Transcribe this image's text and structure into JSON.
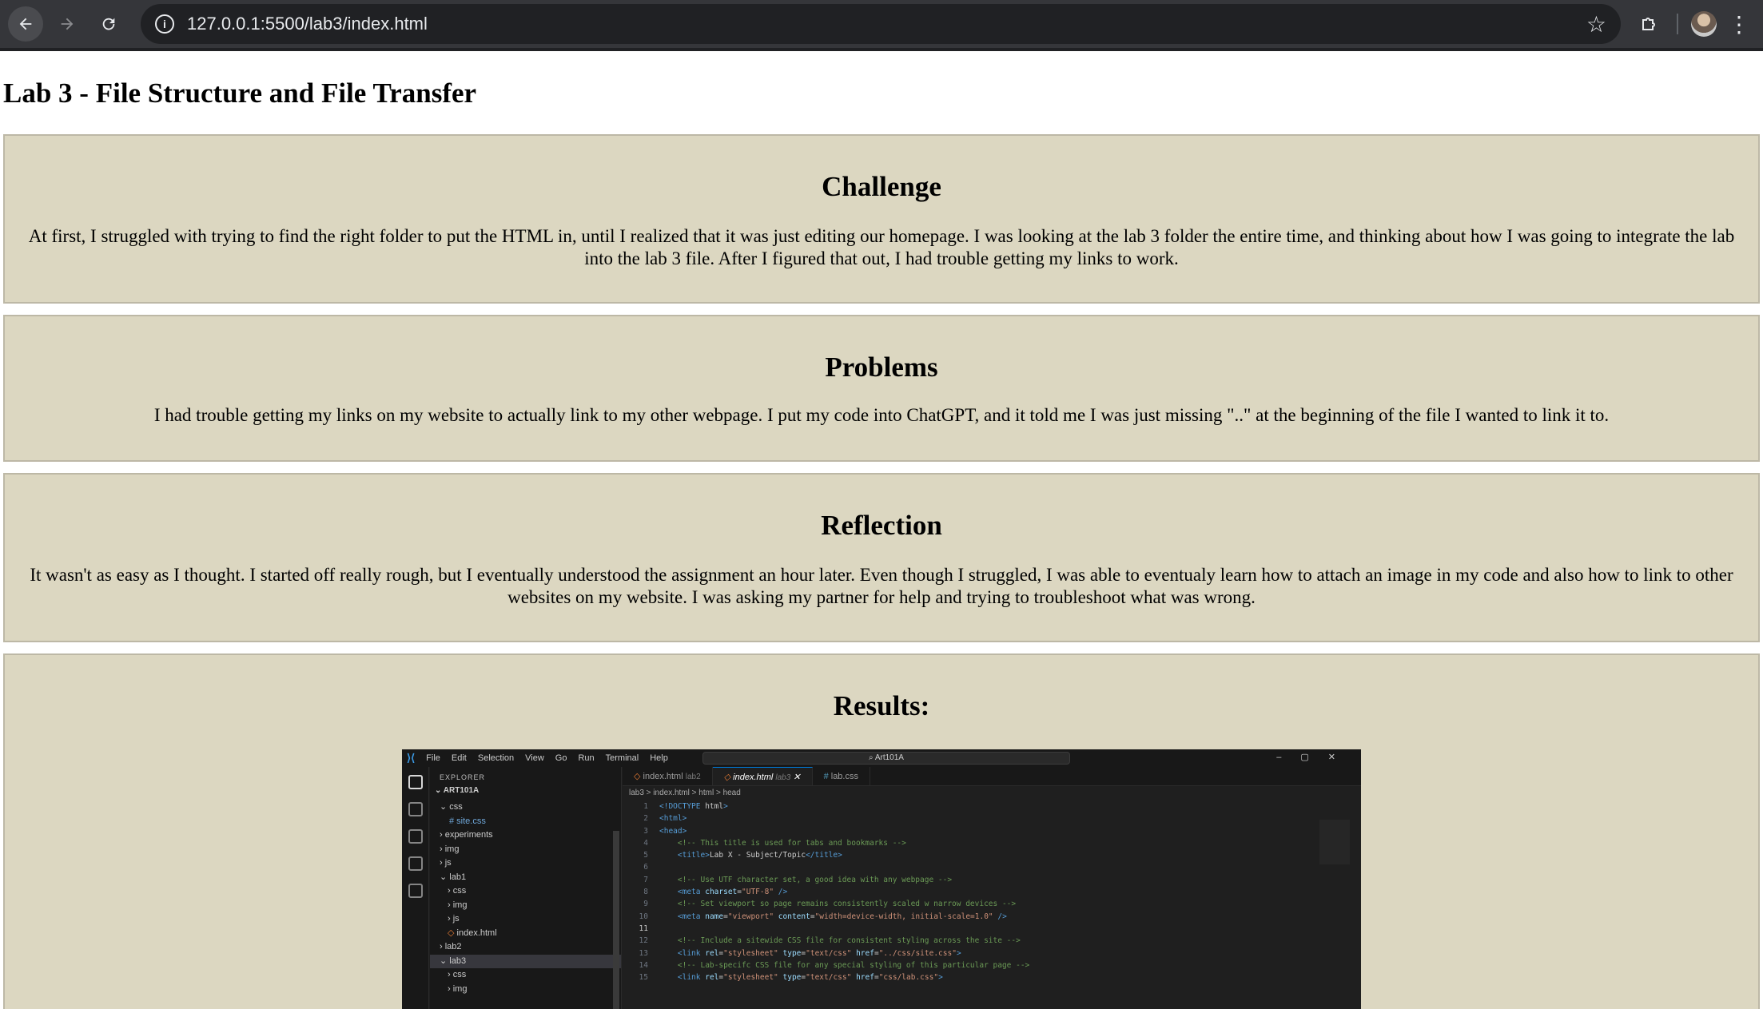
{
  "browser": {
    "url": "127.0.0.1:5500/lab3/index.html"
  },
  "page": {
    "title": "Lab 3 - File Structure and File Transfer",
    "sections": [
      {
        "heading": "Challenge",
        "text": "At first, I struggled with trying to find the right folder to put the HTML in, until I realized that it was just editing our homepage. I was looking at the lab 3 folder the entire time, and thinking about how I was going to integrate the lab into the lab 3 file. After I figured that out, I had trouble getting my links to work."
      },
      {
        "heading": "Problems",
        "text": "I had trouble getting my links on my website to actually link to my other webpage. I put my code into ChatGPT, and it told me I was just missing \"..\" at the beginning of the file I wanted to link it to."
      },
      {
        "heading": "Reflection",
        "text": "It wasn't as easy as I thought. I started off really rough, but I eventually understood the assignment an hour later. Even though I struggled, I was able to eventualy learn how to attach an image in my code and also how to link to other websites on my website. I was asking my partner for help and trying to troubleshoot what was wrong."
      },
      {
        "heading": "Results:"
      }
    ]
  },
  "vscode": {
    "menu": [
      "File",
      "Edit",
      "Selection",
      "View",
      "Go",
      "Run",
      "Terminal",
      "Help"
    ],
    "search": "Art101A",
    "explorer_title": "EXPLORER",
    "project": "ART101A",
    "tree": [
      "css",
      "# site.css",
      "experiments",
      "img",
      "js",
      "lab1",
      "css",
      "img",
      "js",
      "index.html",
      "lab2",
      "lab3",
      "css",
      "img"
    ],
    "tabs": [
      {
        "name": "index.html",
        "dir": "lab2"
      },
      {
        "name": "index.html",
        "dir": "lab3"
      },
      {
        "name": "lab.css",
        "dir": ""
      }
    ],
    "breadcrumb": "lab3 > index.html > html > head",
    "code_lines": [
      "<!DOCTYPE html>",
      "<html>",
      "<head>",
      "    <!-- This title is used for tabs and bookmarks -->",
      "    <title>Lab X - Subject/Topic</title>",
      "",
      "    <!-- Use UTF character set, a good idea with any webpage -->",
      "    <meta charset=\"UTF-8\" />",
      "    <!-- Set viewport so page remains consistently scaled w narrow devices -->",
      "    <meta name=\"viewport\" content=\"width=device-width, initial-scale=1.0\" />",
      "",
      "    <!-- Include a sitewide CSS file for consistent styling across the site -->",
      "    <link rel=\"stylesheet\" type=\"text/css\" href=\"../css/site.css\">",
      "    <!-- Lab-specifc CSS file for any special styling of this particular page -->",
      "    <link rel=\"stylesheet\" type=\"text/css\" href=\"css/lab.css\">"
    ]
  }
}
